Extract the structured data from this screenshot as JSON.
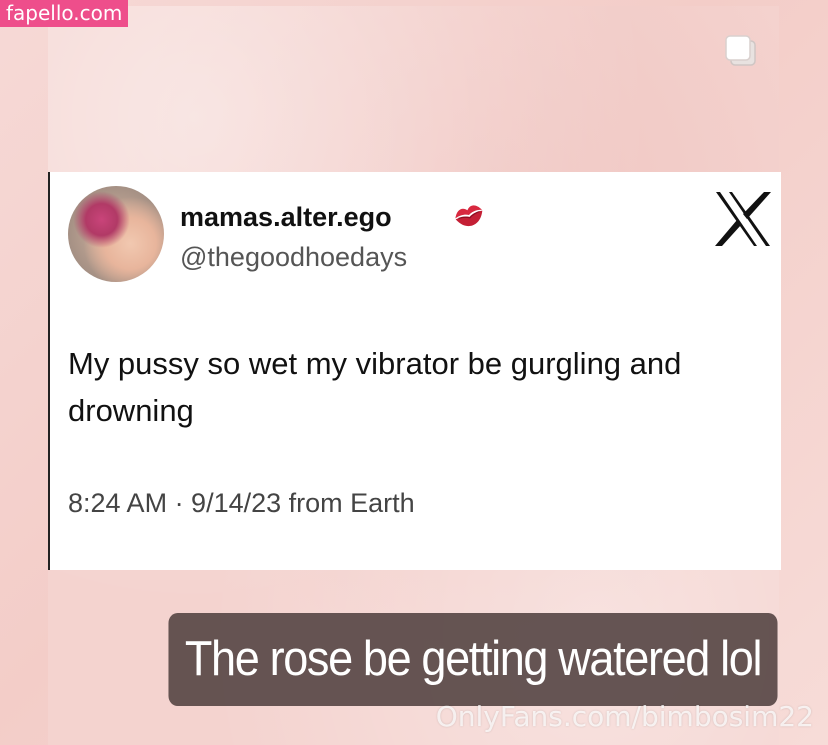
{
  "watermark_top": "fapello.com",
  "tweet": {
    "display_name": "mamas.alter.ego",
    "handle": "@thegoodhoedays",
    "text": "My pussy so wet my vibrator be gurgling and drowning",
    "meta": "8:24 AM · 9/14/23 from Earth",
    "name_emoji": "kiss-mark-icon",
    "platform_icon": "x-logo-icon"
  },
  "caption": "The rose be getting watered lol",
  "watermark_bottom": "OnlyFans.com/bimbosim22",
  "colors": {
    "watermark_pink": "#ee4e8b",
    "caption_bg": "#584846",
    "background": "#f4d3cf"
  }
}
